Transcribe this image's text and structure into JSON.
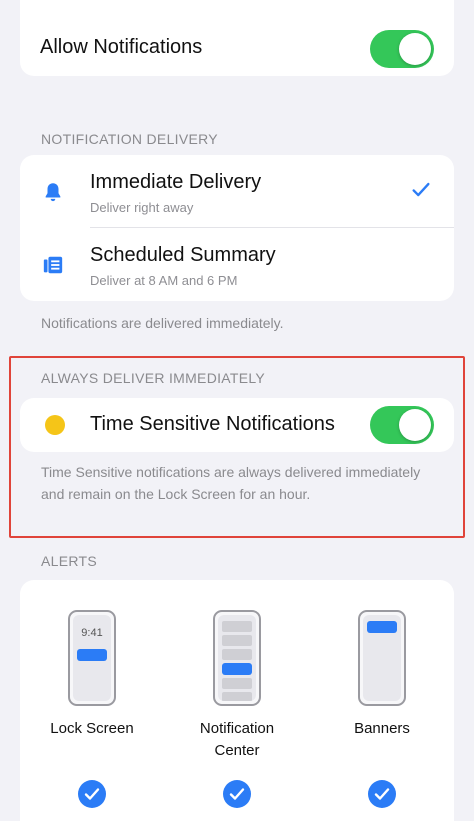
{
  "allow": {
    "label": "Allow Notifications",
    "enabled": true
  },
  "delivery": {
    "header": "NOTIFICATION DELIVERY",
    "items": [
      {
        "title": "Immediate Delivery",
        "subtitle": "Deliver right away",
        "icon": "bell-icon",
        "selected": true
      },
      {
        "title": "Scheduled Summary",
        "subtitle": "Deliver at 8 AM and 6 PM",
        "icon": "summary-icon",
        "selected": false
      }
    ],
    "footer": "Notifications are delivered immediately."
  },
  "always": {
    "header": "ALWAYS DELIVER IMMEDIATELY",
    "label": "Time Sensitive Notifications",
    "enabled": true,
    "footer": "Time Sensitive notifications are always delivered immediately and remain on the Lock Screen for an hour."
  },
  "alerts": {
    "header": "ALERTS",
    "items": [
      {
        "label": "Lock Screen",
        "time": "9:41",
        "checked": true
      },
      {
        "label": "Notification Center",
        "checked": true
      },
      {
        "label": "Banners",
        "checked": true
      }
    ]
  },
  "colors": {
    "accent": "#2b7cf6",
    "toggle_on": "#34c759",
    "highlight": "#e0443a",
    "time_sensitive_dot": "#f5c518"
  }
}
